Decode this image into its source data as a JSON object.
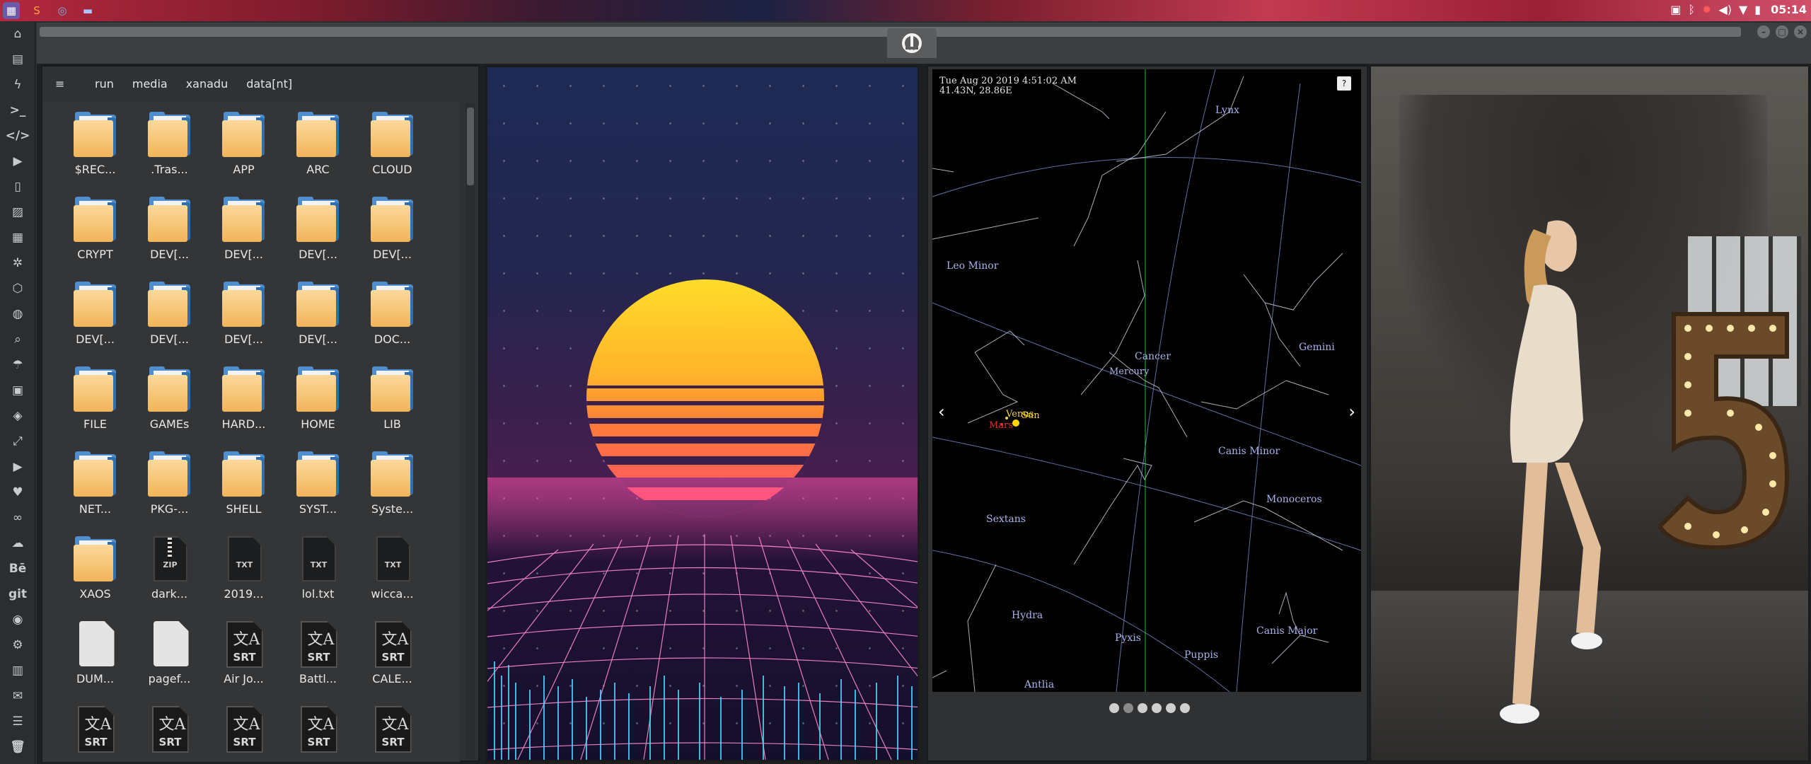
{
  "topbar": {
    "clock": "05:14",
    "launchers": [
      "app-menu-icon",
      "sublime-icon",
      "chrome-icon",
      "files-icon"
    ],
    "tray": [
      "screenshot-icon",
      "bluetooth-icon",
      "bug-icon",
      "volume-icon",
      "wifi-icon",
      "battery-icon"
    ]
  },
  "dock": {
    "items": [
      {
        "name": "home-icon",
        "glyph": "⌂"
      },
      {
        "name": "document-icon",
        "glyph": "▤"
      },
      {
        "name": "bolt-icon",
        "glyph": "ϟ"
      },
      {
        "name": "terminal-icon",
        "glyph": ">_"
      },
      {
        "name": "code-icon",
        "glyph": "</>"
      },
      {
        "name": "play-icon",
        "glyph": "▶"
      },
      {
        "name": "phone-icon",
        "glyph": "▯"
      },
      {
        "name": "image-icon",
        "glyph": "▨"
      },
      {
        "name": "news-icon",
        "glyph": "▦"
      },
      {
        "name": "settings-icon",
        "glyph": "✲"
      },
      {
        "name": "hexagon-icon",
        "glyph": "⬡"
      },
      {
        "name": "globe-icon",
        "glyph": "◍"
      },
      {
        "name": "search-icon",
        "glyph": "⌕"
      },
      {
        "name": "umbrella-icon",
        "glyph": "☂"
      },
      {
        "name": "contact-icon",
        "glyph": "▣"
      },
      {
        "name": "diamond-icon",
        "glyph": "◈"
      },
      {
        "name": "expand-icon",
        "glyph": "⤢"
      },
      {
        "name": "youtube-icon",
        "glyph": "▶"
      },
      {
        "name": "heart-icon",
        "glyph": "♥"
      },
      {
        "name": "link-icon",
        "glyph": "∞"
      },
      {
        "name": "cloud-icon",
        "glyph": "☁"
      },
      {
        "name": "behance-icon",
        "glyph": "Bē"
      },
      {
        "name": "git-icon",
        "glyph": "git"
      },
      {
        "name": "github-icon",
        "glyph": "◉"
      },
      {
        "name": "bike-icon",
        "glyph": "⚙"
      },
      {
        "name": "map-icon",
        "glyph": "▥"
      },
      {
        "name": "mail-icon",
        "glyph": "✉"
      },
      {
        "name": "server-icon",
        "glyph": "☰"
      },
      {
        "name": "trash-icon",
        "glyph": "🗑"
      }
    ]
  },
  "window": {
    "controls": [
      "–",
      "□",
      "×"
    ]
  },
  "file_manager": {
    "breadcrumbs": [
      "run",
      "media",
      "xanadu",
      "data[nt]"
    ],
    "items": [
      {
        "type": "folder",
        "label": "$REC..."
      },
      {
        "type": "folder",
        "label": ".Tras..."
      },
      {
        "type": "folder",
        "label": "APP"
      },
      {
        "type": "folder",
        "label": "ARC"
      },
      {
        "type": "folder",
        "label": "CLOUD"
      },
      {
        "type": "folder",
        "label": "CRYPT"
      },
      {
        "type": "folder",
        "label": "DEV[..."
      },
      {
        "type": "folder",
        "label": "DEV[..."
      },
      {
        "type": "folder",
        "label": "DEV[..."
      },
      {
        "type": "folder",
        "label": "DEV[..."
      },
      {
        "type": "folder",
        "label": "DEV[..."
      },
      {
        "type": "folder",
        "label": "DEV[..."
      },
      {
        "type": "folder",
        "label": "DEV[..."
      },
      {
        "type": "folder",
        "label": "DEV[..."
      },
      {
        "type": "folder",
        "label": "DOC..."
      },
      {
        "type": "folder",
        "label": "FILE"
      },
      {
        "type": "folder",
        "label": "GAMEs"
      },
      {
        "type": "folder",
        "label": "HARD..."
      },
      {
        "type": "folder",
        "label": "HOME"
      },
      {
        "type": "folder",
        "label": "LIB"
      },
      {
        "type": "folder",
        "label": "NET..."
      },
      {
        "type": "folder",
        "label": "PKG-..."
      },
      {
        "type": "folder",
        "label": "SHELL"
      },
      {
        "type": "folder",
        "label": "SYST..."
      },
      {
        "type": "folder",
        "label": "Syste..."
      },
      {
        "type": "folder",
        "label": "XAOS"
      },
      {
        "type": "zip",
        "label": "dark...",
        "tag": "ZIP"
      },
      {
        "type": "txt",
        "label": "2019...",
        "tag": "TXT"
      },
      {
        "type": "txt",
        "label": "lol.txt",
        "tag": "TXT"
      },
      {
        "type": "txt",
        "label": "wicca...",
        "tag": "TXT"
      },
      {
        "type": "blank",
        "label": "DUM..."
      },
      {
        "type": "blank",
        "label": "pagef..."
      },
      {
        "type": "srt",
        "label": "Air Jo...",
        "tag": "SRT"
      },
      {
        "type": "srt",
        "label": "Battl...",
        "tag": "SRT"
      },
      {
        "type": "srt",
        "label": "CALE...",
        "tag": "SRT"
      },
      {
        "type": "srt",
        "label": "",
        "tag": "SRT"
      },
      {
        "type": "srt",
        "label": "",
        "tag": "SRT"
      },
      {
        "type": "srt",
        "label": "",
        "tag": "SRT"
      },
      {
        "type": "srt",
        "label": "",
        "tag": "SRT"
      },
      {
        "type": "srt",
        "label": "",
        "tag": "SRT"
      }
    ]
  },
  "sky": {
    "datetime": "Tue Aug 20 2019 4:51:02 AM",
    "location": "41.43N, 28.86E",
    "help": "?",
    "prev": "‹",
    "next": "›",
    "constellations": [
      "Lynx",
      "Leo Minor",
      "Gemini",
      "Cancer",
      "Canis Minor",
      "Monoceros",
      "Sextans",
      "Hydra",
      "Pyxis",
      "Canis Major",
      "Puppis",
      "Antlia"
    ],
    "planets": [
      {
        "name": "Venus",
        "color": "#f2d24a"
      },
      {
        "name": "Sun",
        "color": "#ffd800"
      },
      {
        "name": "Mars",
        "color": "#e0312f"
      },
      {
        "name": "Mercury",
        "color": "#aab3ea"
      }
    ],
    "pager": {
      "count": 6,
      "active": 1
    }
  },
  "colors": {
    "accent": "#4f8fd0",
    "folder": "#f2b45a",
    "sky_lines": "#7d8cc8"
  }
}
